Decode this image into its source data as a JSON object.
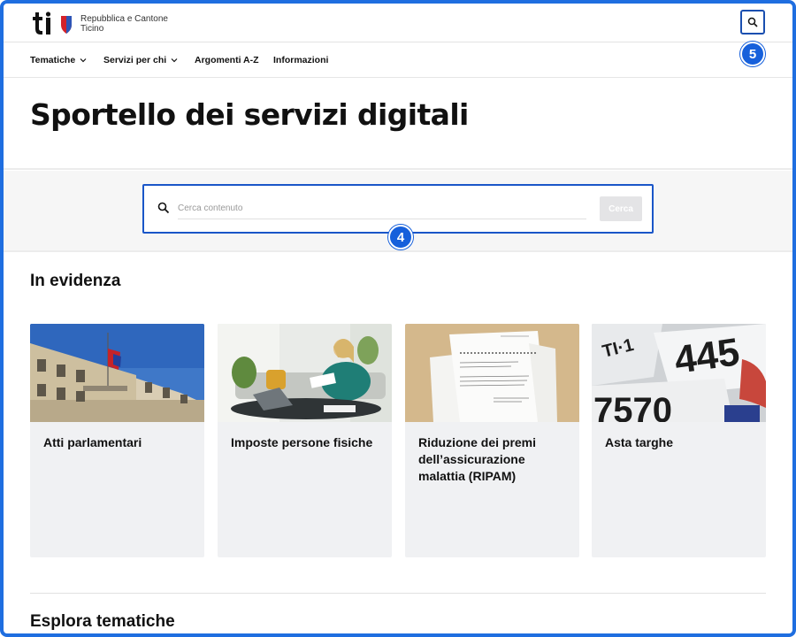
{
  "header": {
    "logo_text_line1": "Repubblica e Cantone",
    "logo_text_line2": "Ticino",
    "search_icon": "search-icon"
  },
  "annotations": {
    "badge_search": "5",
    "badge_searchbar": "4"
  },
  "nav": {
    "items": [
      {
        "label": "Tematiche",
        "has_dropdown": true
      },
      {
        "label": "Servizi per chi",
        "has_dropdown": true
      },
      {
        "label": "Argomenti A-Z",
        "has_dropdown": false
      },
      {
        "label": "Informazioni",
        "has_dropdown": false
      }
    ]
  },
  "page": {
    "title": "Sportello dei servizi digitali"
  },
  "search": {
    "placeholder": "Cerca contenuto",
    "value": "",
    "button_label": "Cerca"
  },
  "featured": {
    "heading": "In evidenza",
    "cards": [
      {
        "title": "Atti parlamentari",
        "image": "palazzo-flags-photo"
      },
      {
        "title": "Imposte persone fisiche",
        "image": "woman-laptop-photo"
      },
      {
        "title": "Riduzione dei premi dell’assicurazione malattia (RIPAM)",
        "image": "documents-photo"
      },
      {
        "title": "Asta targhe",
        "image": "license-plates-photo"
      }
    ]
  },
  "explore": {
    "heading": "Esplora tematiche"
  },
  "colors": {
    "accent_blue": "#1660db",
    "card_bg": "#f0f1f3",
    "disabled_button": "#e4e4e6"
  }
}
